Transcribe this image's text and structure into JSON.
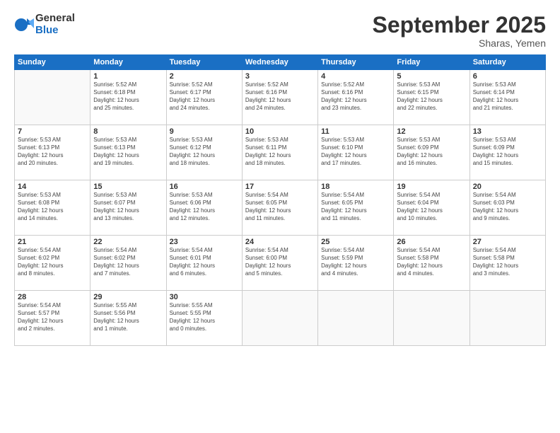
{
  "logo": {
    "general": "General",
    "blue": "Blue"
  },
  "title": "September 2025",
  "subtitle": "Sharas, Yemen",
  "days_header": [
    "Sunday",
    "Monday",
    "Tuesday",
    "Wednesday",
    "Thursday",
    "Friday",
    "Saturday"
  ],
  "weeks": [
    [
      {
        "num": "",
        "info": ""
      },
      {
        "num": "1",
        "info": "Sunrise: 5:52 AM\nSunset: 6:18 PM\nDaylight: 12 hours\nand 25 minutes."
      },
      {
        "num": "2",
        "info": "Sunrise: 5:52 AM\nSunset: 6:17 PM\nDaylight: 12 hours\nand 24 minutes."
      },
      {
        "num": "3",
        "info": "Sunrise: 5:52 AM\nSunset: 6:16 PM\nDaylight: 12 hours\nand 24 minutes."
      },
      {
        "num": "4",
        "info": "Sunrise: 5:52 AM\nSunset: 6:16 PM\nDaylight: 12 hours\nand 23 minutes."
      },
      {
        "num": "5",
        "info": "Sunrise: 5:53 AM\nSunset: 6:15 PM\nDaylight: 12 hours\nand 22 minutes."
      },
      {
        "num": "6",
        "info": "Sunrise: 5:53 AM\nSunset: 6:14 PM\nDaylight: 12 hours\nand 21 minutes."
      }
    ],
    [
      {
        "num": "7",
        "info": "Sunrise: 5:53 AM\nSunset: 6:13 PM\nDaylight: 12 hours\nand 20 minutes."
      },
      {
        "num": "8",
        "info": "Sunrise: 5:53 AM\nSunset: 6:13 PM\nDaylight: 12 hours\nand 19 minutes."
      },
      {
        "num": "9",
        "info": "Sunrise: 5:53 AM\nSunset: 6:12 PM\nDaylight: 12 hours\nand 18 minutes."
      },
      {
        "num": "10",
        "info": "Sunrise: 5:53 AM\nSunset: 6:11 PM\nDaylight: 12 hours\nand 18 minutes."
      },
      {
        "num": "11",
        "info": "Sunrise: 5:53 AM\nSunset: 6:10 PM\nDaylight: 12 hours\nand 17 minutes."
      },
      {
        "num": "12",
        "info": "Sunrise: 5:53 AM\nSunset: 6:09 PM\nDaylight: 12 hours\nand 16 minutes."
      },
      {
        "num": "13",
        "info": "Sunrise: 5:53 AM\nSunset: 6:09 PM\nDaylight: 12 hours\nand 15 minutes."
      }
    ],
    [
      {
        "num": "14",
        "info": "Sunrise: 5:53 AM\nSunset: 6:08 PM\nDaylight: 12 hours\nand 14 minutes."
      },
      {
        "num": "15",
        "info": "Sunrise: 5:53 AM\nSunset: 6:07 PM\nDaylight: 12 hours\nand 13 minutes."
      },
      {
        "num": "16",
        "info": "Sunrise: 5:53 AM\nSunset: 6:06 PM\nDaylight: 12 hours\nand 12 minutes."
      },
      {
        "num": "17",
        "info": "Sunrise: 5:54 AM\nSunset: 6:05 PM\nDaylight: 12 hours\nand 11 minutes."
      },
      {
        "num": "18",
        "info": "Sunrise: 5:54 AM\nSunset: 6:05 PM\nDaylight: 12 hours\nand 11 minutes."
      },
      {
        "num": "19",
        "info": "Sunrise: 5:54 AM\nSunset: 6:04 PM\nDaylight: 12 hours\nand 10 minutes."
      },
      {
        "num": "20",
        "info": "Sunrise: 5:54 AM\nSunset: 6:03 PM\nDaylight: 12 hours\nand 9 minutes."
      }
    ],
    [
      {
        "num": "21",
        "info": "Sunrise: 5:54 AM\nSunset: 6:02 PM\nDaylight: 12 hours\nand 8 minutes."
      },
      {
        "num": "22",
        "info": "Sunrise: 5:54 AM\nSunset: 6:02 PM\nDaylight: 12 hours\nand 7 minutes."
      },
      {
        "num": "23",
        "info": "Sunrise: 5:54 AM\nSunset: 6:01 PM\nDaylight: 12 hours\nand 6 minutes."
      },
      {
        "num": "24",
        "info": "Sunrise: 5:54 AM\nSunset: 6:00 PM\nDaylight: 12 hours\nand 5 minutes."
      },
      {
        "num": "25",
        "info": "Sunrise: 5:54 AM\nSunset: 5:59 PM\nDaylight: 12 hours\nand 4 minutes."
      },
      {
        "num": "26",
        "info": "Sunrise: 5:54 AM\nSunset: 5:58 PM\nDaylight: 12 hours\nand 4 minutes."
      },
      {
        "num": "27",
        "info": "Sunrise: 5:54 AM\nSunset: 5:58 PM\nDaylight: 12 hours\nand 3 minutes."
      }
    ],
    [
      {
        "num": "28",
        "info": "Sunrise: 5:54 AM\nSunset: 5:57 PM\nDaylight: 12 hours\nand 2 minutes."
      },
      {
        "num": "29",
        "info": "Sunrise: 5:55 AM\nSunset: 5:56 PM\nDaylight: 12 hours\nand 1 minute."
      },
      {
        "num": "30",
        "info": "Sunrise: 5:55 AM\nSunset: 5:55 PM\nDaylight: 12 hours\nand 0 minutes."
      },
      {
        "num": "",
        "info": ""
      },
      {
        "num": "",
        "info": ""
      },
      {
        "num": "",
        "info": ""
      },
      {
        "num": "",
        "info": ""
      }
    ]
  ]
}
